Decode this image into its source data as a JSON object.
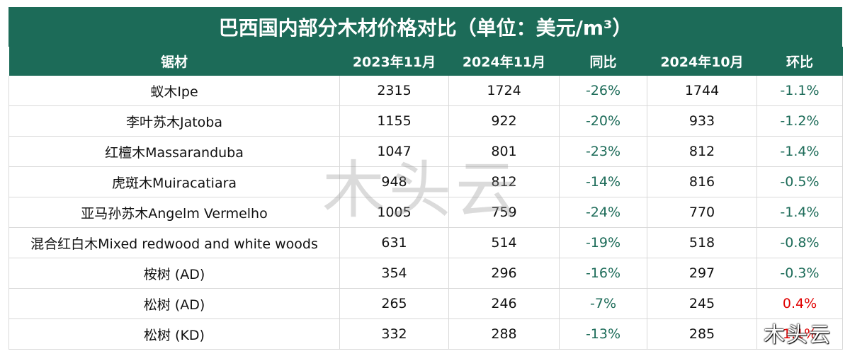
{
  "title": "巴西国内部分木材价格对比（单位：美元/m³）",
  "headers": [
    "锯材",
    "2023年11月",
    "2024年11月",
    "同比",
    "2024年10月",
    "环比"
  ],
  "rows": [
    {
      "name": "蚁木Ipe",
      "v2023": "2315",
      "v2024": "1724",
      "yoy": "-26%",
      "oct": "1744",
      "mom": "-1.1%"
    },
    {
      "name": "李叶苏木Jatoba",
      "v2023": "1155",
      "v2024": "922",
      "yoy": "-20%",
      "oct": "933",
      "mom": "-1.2%"
    },
    {
      "name": "红檀木Massaranduba",
      "v2023": "1047",
      "v2024": "801",
      "yoy": "-23%",
      "oct": "812",
      "mom": "-1.4%"
    },
    {
      "name": "虎斑木Muiracatiara",
      "v2023": "948",
      "v2024": "812",
      "yoy": "-14%",
      "oct": "816",
      "mom": "-0.5%"
    },
    {
      "name": "亚马孙苏木Angelm Vermelho",
      "v2023": "1005",
      "v2024": "759",
      "yoy": "-24%",
      "oct": "770",
      "mom": "-1.4%"
    },
    {
      "name": "混合红白木Mixed redwood and white woods",
      "v2023": "631",
      "v2024": "514",
      "yoy": "-19%",
      "oct": "518",
      "mom": "-0.8%"
    },
    {
      "name": "桉树 (AD)",
      "v2023": "354",
      "v2024": "296",
      "yoy": "-16%",
      "oct": "297",
      "mom": "-0.3%"
    },
    {
      "name": "松树 (AD)",
      "v2023": "265",
      "v2024": "246",
      "yoy": "-7%",
      "oct": "245",
      "mom": "0.4%"
    },
    {
      "name": "松树 (KD)",
      "v2023": "332",
      "v2024": "288",
      "yoy": "-13%",
      "oct": "285",
      "mom": "1.1%"
    }
  ],
  "watermark": "木头云",
  "colors": {
    "header_bg": "#1c6b58",
    "negative": "#1c6b58",
    "positive": "#e00000"
  }
}
